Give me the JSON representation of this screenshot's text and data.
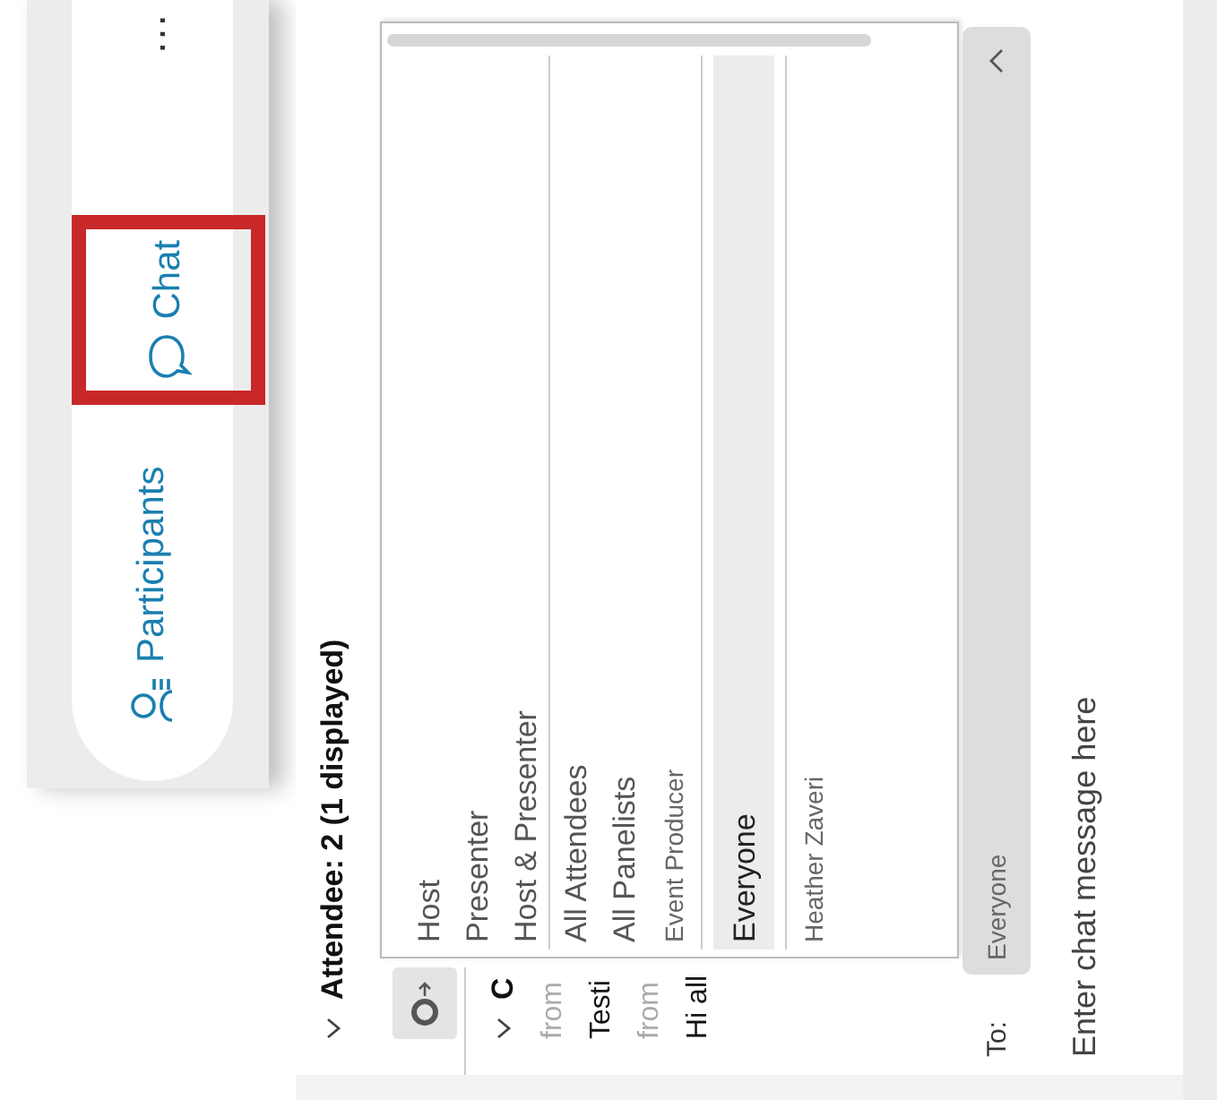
{
  "toolbar": {
    "items": [
      {
        "kind": "participants",
        "label": "Participants"
      },
      {
        "kind": "chat",
        "label": "Chat",
        "highlighted": true
      },
      {
        "kind": "more",
        "label": "…"
      }
    ]
  },
  "chat_panel": {
    "attendee_header": {
      "label": "Attendee: 2 (1 displayed)",
      "expanded": true
    },
    "chat_header": {
      "label": "C",
      "expanded": true
    },
    "messages": [
      {
        "from": "from",
        "text": "Testi"
      },
      {
        "from": "from",
        "text": "Hi all"
      }
    ],
    "recipient_menu": {
      "groups": [
        [
          {
            "label": "Host",
            "kind": "role",
            "selected": false
          },
          {
            "label": "Presenter",
            "kind": "role",
            "selected": false
          },
          {
            "label": "Host & Presenter",
            "kind": "role",
            "selected": false
          }
        ],
        [
          {
            "label": "All Attendees",
            "kind": "role",
            "selected": false
          },
          {
            "label": "All Panelists",
            "kind": "role",
            "selected": false
          },
          {
            "label": "Event Producer",
            "kind": "person",
            "selected": false
          }
        ],
        [
          {
            "label": "Everyone",
            "kind": "role",
            "selected": true
          }
        ],
        [
          {
            "label": "Heather Zaveri",
            "kind": "person",
            "selected": false
          }
        ]
      ]
    },
    "to": {
      "label": "To:",
      "value": "Everyone",
      "expanded": true
    },
    "message_input": {
      "placeholder": "Enter chat message here"
    }
  }
}
